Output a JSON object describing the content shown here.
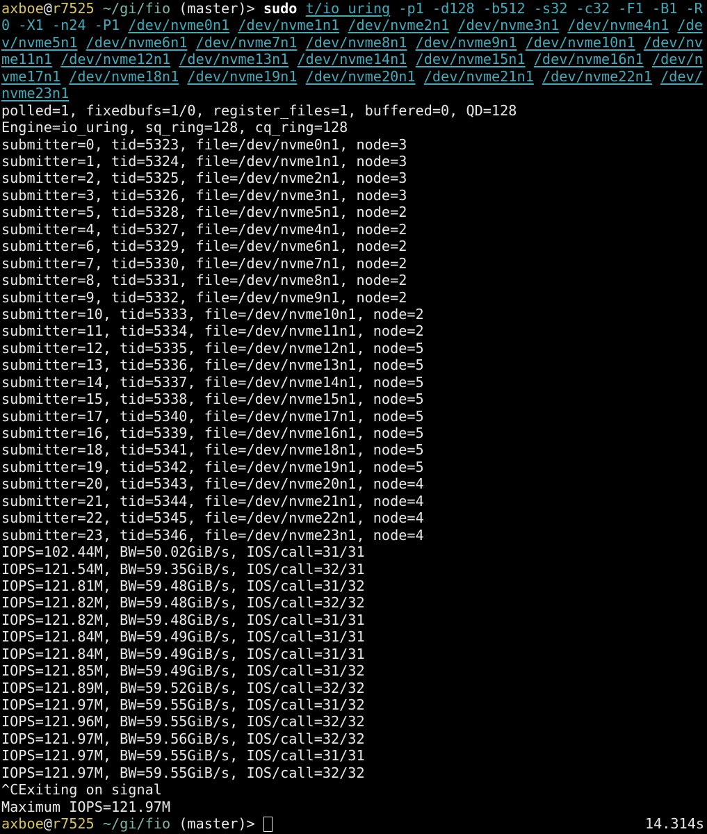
{
  "prompt": {
    "user": "axboe",
    "at": "@",
    "host": "r7525",
    "cwd": "~/gi/fio",
    "branch": "(master)",
    "symbol": ">"
  },
  "command": {
    "program": "sudo",
    "binary": "t/io_uring",
    "args": "-p1 -d128 -b512 -s32 -c32 -F1 -B1 -R0 -X1 -n24 -P1",
    "devices": [
      "/dev/nvme0n1",
      "/dev/nvme1n1",
      "/dev/nvme2n1",
      "/dev/nvme3n1",
      "/dev/nvme4n1",
      "/dev/nvme5n1",
      "/dev/nvme6n1",
      "/dev/nvme7n1",
      "/dev/nvme8n1",
      "/dev/nvme9n1",
      "/dev/nvme10n1",
      "/dev/nvme11n1",
      "/dev/nvme12n1",
      "/dev/nvme13n1",
      "/dev/nvme14n1",
      "/dev/nvme15n1",
      "/dev/nvme16n1",
      "/dev/nvme17n1",
      "/dev/nvme18n1",
      "/dev/nvme19n1",
      "/dev/nvme20n1",
      "/dev/nvme21n1",
      "/dev/nvme22n1",
      "/dev/nvme23n1"
    ]
  },
  "output": {
    "config_lines": [
      "polled=1, fixedbufs=1/0, register_files=1, buffered=0, QD=128",
      "Engine=io_uring, sq_ring=128, cq_ring=128"
    ],
    "submitters": [
      "submitter=0, tid=5323, file=/dev/nvme0n1, node=3",
      "submitter=1, tid=5324, file=/dev/nvme1n1, node=3",
      "submitter=2, tid=5325, file=/dev/nvme2n1, node=3",
      "submitter=3, tid=5326, file=/dev/nvme3n1, node=3",
      "submitter=5, tid=5328, file=/dev/nvme5n1, node=2",
      "submitter=4, tid=5327, file=/dev/nvme4n1, node=2",
      "submitter=6, tid=5329, file=/dev/nvme6n1, node=2",
      "submitter=7, tid=5330, file=/dev/nvme7n1, node=2",
      "submitter=8, tid=5331, file=/dev/nvme8n1, node=2",
      "submitter=9, tid=5332, file=/dev/nvme9n1, node=2",
      "submitter=10, tid=5333, file=/dev/nvme10n1, node=2",
      "submitter=11, tid=5334, file=/dev/nvme11n1, node=2",
      "submitter=12, tid=5335, file=/dev/nvme12n1, node=5",
      "submitter=13, tid=5336, file=/dev/nvme13n1, node=5",
      "submitter=14, tid=5337, file=/dev/nvme14n1, node=5",
      "submitter=15, tid=5338, file=/dev/nvme15n1, node=5",
      "submitter=17, tid=5340, file=/dev/nvme17n1, node=5",
      "submitter=16, tid=5339, file=/dev/nvme16n1, node=5",
      "submitter=18, tid=5341, file=/dev/nvme18n1, node=5",
      "submitter=19, tid=5342, file=/dev/nvme19n1, node=5",
      "submitter=20, tid=5343, file=/dev/nvme20n1, node=4",
      "submitter=21, tid=5344, file=/dev/nvme21n1, node=4",
      "submitter=22, tid=5345, file=/dev/nvme22n1, node=4",
      "submitter=23, tid=5346, file=/dev/nvme23n1, node=4"
    ],
    "stats": [
      "IOPS=102.44M, BW=50.02GiB/s, IOS/call=31/31",
      "IOPS=121.54M, BW=59.35GiB/s, IOS/call=32/31",
      "IOPS=121.81M, BW=59.48GiB/s, IOS/call=31/32",
      "IOPS=121.82M, BW=59.48GiB/s, IOS/call=32/32",
      "IOPS=121.82M, BW=59.48GiB/s, IOS/call=31/31",
      "IOPS=121.84M, BW=59.49GiB/s, IOS/call=31/31",
      "IOPS=121.84M, BW=59.49GiB/s, IOS/call=31/31",
      "IOPS=121.85M, BW=59.49GiB/s, IOS/call=31/32",
      "IOPS=121.89M, BW=59.52GiB/s, IOS/call=32/32",
      "IOPS=121.97M, BW=59.55GiB/s, IOS/call=31/32",
      "IOPS=121.96M, BW=59.55GiB/s, IOS/call=32/32",
      "IOPS=121.97M, BW=59.56GiB/s, IOS/call=32/32",
      "IOPS=121.97M, BW=59.55GiB/s, IOS/call=31/31",
      "IOPS=121.97M, BW=59.55GiB/s, IOS/call=32/32"
    ],
    "exit_line": "^CExiting on signal",
    "max_line": "Maximum IOPS=121.97M"
  },
  "status": {
    "duration": "14.314s"
  },
  "colors": {
    "background": "#000000",
    "foreground": "#e8e8e8",
    "prompt_user": "#d7c565",
    "prompt_cwd": "#7fb4a8",
    "argument": "#45a9b8"
  }
}
